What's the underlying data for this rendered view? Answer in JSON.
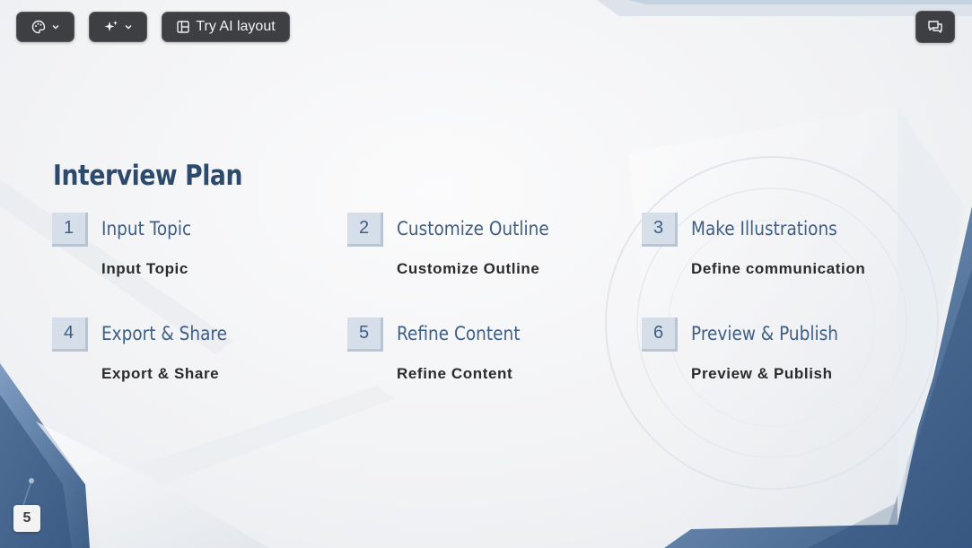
{
  "toolbar": {
    "theme_icon": "palette-icon",
    "ai_icon": "sparkle-icon",
    "layout_label": "Try AI layout",
    "layout_icon": "layout-icon",
    "comment_icon": "comment-icon"
  },
  "slide": {
    "title": "Interview Plan",
    "steps": [
      {
        "num": "1",
        "heading": "Input Topic",
        "text": "Input Topic"
      },
      {
        "num": "2",
        "heading": "Customize Outline",
        "text": "Customize Outline"
      },
      {
        "num": "3",
        "heading": "Make Illustrations",
        "text": "Define communication"
      },
      {
        "num": "4",
        "heading": "Export & Share",
        "text": "Export & Share"
      },
      {
        "num": "5",
        "heading": "Refine Content",
        "text": "Refine Content"
      },
      {
        "num": "6",
        "heading": "Preview & Publish",
        "text": "Preview & Publish"
      }
    ],
    "page_number": "5"
  },
  "colors": {
    "accent": "#3f5e84",
    "title": "#2c4a6e",
    "toolbar": "#3d3f43",
    "decoration": "#5b7ba3"
  }
}
